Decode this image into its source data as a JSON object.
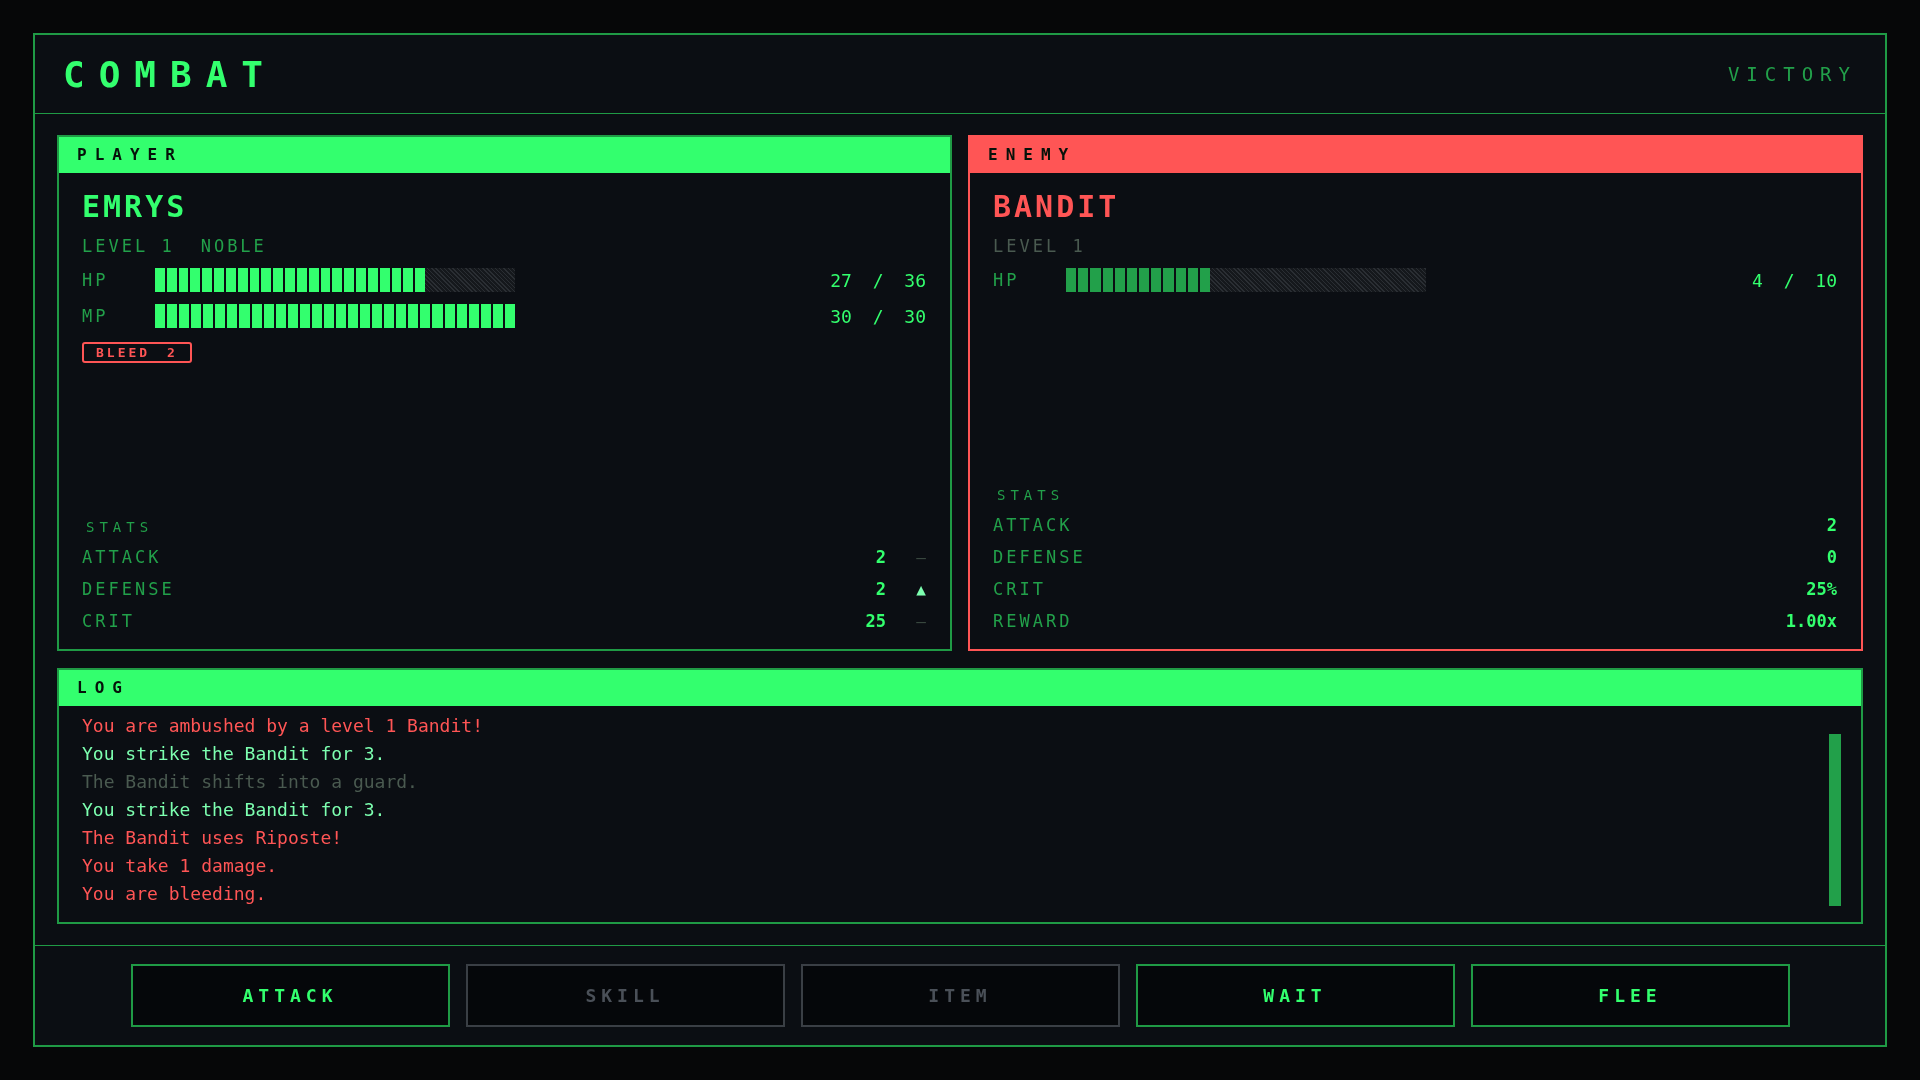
{
  "header": {
    "title": "COMBAT",
    "status": "VICTORY"
  },
  "player": {
    "tag": "PLAYER",
    "name": "EMRYS",
    "info": [
      "LEVEL 1",
      "NOBLE"
    ],
    "bars": [
      {
        "label": "HP",
        "level": 0.75,
        "reading": "27 / 36"
      },
      {
        "label": "MP",
        "level": 1.0,
        "reading": "30 / 30"
      }
    ],
    "effects": [
      {
        "label": "BLEED 2"
      }
    ],
    "stats_title": "STATS",
    "stats": [
      {
        "label": "ATTACK",
        "value": "2",
        "trend": "—",
        "kind": "flat"
      },
      {
        "label": "DEFENSE",
        "value": "2",
        "trend": "▲",
        "kind": "up"
      },
      {
        "label": "CRIT",
        "value": "25",
        "trend": "—",
        "kind": "flat"
      }
    ]
  },
  "enemy": {
    "tag": "ENEMY",
    "name": "BANDIT",
    "info": [
      "LEVEL 1"
    ],
    "bars": [
      {
        "label": "HP",
        "level": 0.4,
        "reading": "4 / 10"
      }
    ],
    "stats_title": "STATS",
    "stats": [
      {
        "label": "ATTACK",
        "value": "2"
      },
      {
        "label": "DEFENSE",
        "value": "0"
      },
      {
        "label": "CRIT",
        "value": "25%"
      },
      {
        "label": "REWARD",
        "value": "1.00x"
      }
    ]
  },
  "log": {
    "title": "LOG",
    "lines": [
      {
        "text": "You are ambushed by a level 1 Bandit!",
        "kind": "danger"
      },
      {
        "text": "You strike the Bandit for 3.",
        "kind": "player"
      },
      {
        "text": "The Bandit shifts into a guard.",
        "kind": "neutral"
      },
      {
        "text": "You strike the Bandit for 3.",
        "kind": "player"
      },
      {
        "text": "The Bandit uses Riposte!",
        "kind": "danger"
      },
      {
        "text": "You take 1 damage.",
        "kind": "danger"
      },
      {
        "text": "You are bleeding.",
        "kind": "danger"
      }
    ]
  },
  "actions": [
    {
      "label": "ATTACK",
      "disabled": false
    },
    {
      "label": "SKILL",
      "disabled": true
    },
    {
      "label": "ITEM",
      "disabled": true
    },
    {
      "label": "WAIT",
      "disabled": false
    },
    {
      "label": "FLEE",
      "disabled": false
    }
  ]
}
